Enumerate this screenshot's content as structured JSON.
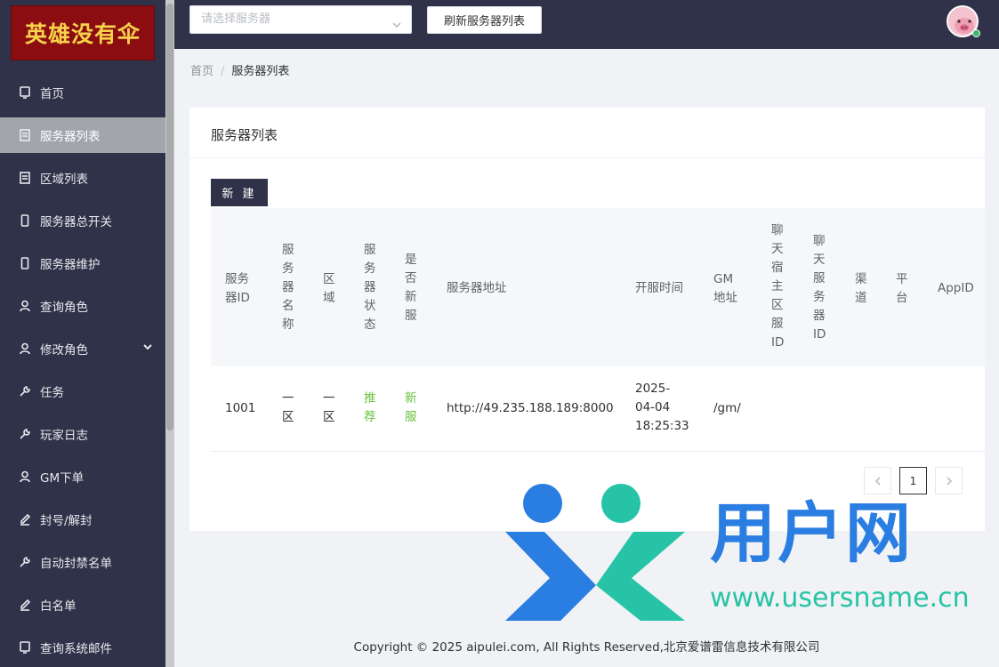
{
  "logo": {
    "text": "英雄没有伞"
  },
  "sidebar": {
    "items": [
      {
        "label": "首页",
        "icon": "monitor-icon"
      },
      {
        "label": "服务器列表",
        "icon": "list-icon",
        "active": true
      },
      {
        "label": "区域列表",
        "icon": "list-icon"
      },
      {
        "label": "服务器总开关",
        "icon": "phone-icon"
      },
      {
        "label": "服务器维护",
        "icon": "phone-icon"
      },
      {
        "label": "查询角色",
        "icon": "user-icon"
      },
      {
        "label": "修改角色",
        "icon": "user-icon",
        "expandable": true
      },
      {
        "label": "任务",
        "icon": "wrench-icon"
      },
      {
        "label": "玩家日志",
        "icon": "wrench-icon"
      },
      {
        "label": "GM下单",
        "icon": "user-icon"
      },
      {
        "label": "封号/解封",
        "icon": "edit-icon"
      },
      {
        "label": "自动封禁名单",
        "icon": "wrench-icon"
      },
      {
        "label": "白名单",
        "icon": "edit-icon"
      },
      {
        "label": "查询系统邮件",
        "icon": "monitor-icon"
      }
    ]
  },
  "header": {
    "server_select_placeholder": "请选择服务器",
    "refresh_label": "刷新服务器列表"
  },
  "breadcrumb": {
    "home": "首页",
    "separator": "/",
    "current": "服务器列表"
  },
  "card": {
    "title": "服务器列表",
    "new_button": "新 建"
  },
  "table": {
    "columns": [
      "服务器ID",
      "服务器名称",
      "区域",
      "服务器状态",
      "是否新服",
      "服务器地址",
      "开服时间",
      "GM地址",
      "聊天宿主区服ID",
      "聊天服务器ID",
      "渠道",
      "平台",
      "AppID"
    ],
    "rows": [
      {
        "id": "1001",
        "name": "一区",
        "region": "一区",
        "status": "推荐",
        "is_new": "新服",
        "address": "http://49.235.188.189:8000",
        "open_time": "2025-04-04 18:25:33",
        "gm_address": "/gm/",
        "chat_host_id": "",
        "chat_server_id": "",
        "channel": "",
        "platform": "",
        "appid": ""
      }
    ]
  },
  "pagination": {
    "current_page": "1"
  },
  "footer": {
    "copyright": "Copyright © 2025 aipulei.com, All Rights Reserved,北京爱谱雷信息技术有限公司"
  },
  "watermark": {
    "brand": "用户网",
    "url": "www.usersname.cn"
  },
  "colors": {
    "sidebar_bg": "#2f3248",
    "active_item": "#a3a5ad",
    "green_text": "#67c23a",
    "watermark_blue": "#2a7de1",
    "watermark_teal": "#27c3a6"
  }
}
